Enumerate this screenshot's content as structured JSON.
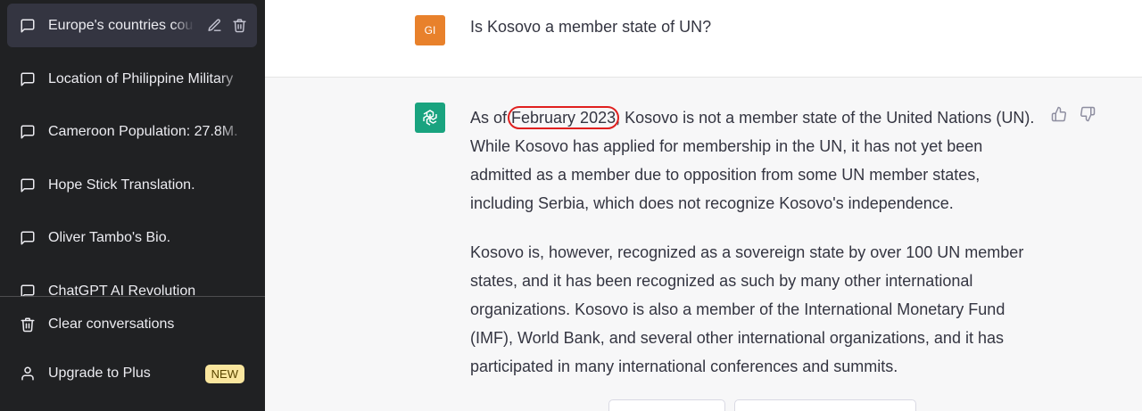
{
  "sidebar": {
    "conversations": [
      {
        "title": "Europe's countries cou"
      },
      {
        "title": "Location of Philippine Military"
      },
      {
        "title": "Cameroon Population: 27.8M."
      },
      {
        "title": "Hope Stick Translation."
      },
      {
        "title": "Oliver Tambo's Bio."
      },
      {
        "title": "ChatGPT AI Revolution"
      }
    ],
    "clear_label": "Clear conversations",
    "upgrade_label": "Upgrade to Plus",
    "upgrade_badge": "NEW"
  },
  "chat": {
    "user_avatar": "GI",
    "user_message": "Is Kosovo a member state of UN?",
    "assistant": {
      "p1_pre": "As of ",
      "p1_highlight": "February 2023",
      "p1_post": ", Kosovo is not a member state of the United Nations (UN). While Kosovo has applied for membership in the UN, it has not yet been admitted as a member due to opposition from some UN member states, including Serbia, which does not recognize Kosovo's independence.",
      "p2": "Kosovo is, however, recognized as a sovereign state by over 100 UN member states, and it has been recognized as such by many other international organizations. Kosovo is also a member of the International Monetary Fund (IMF), World Bank, and several other international organizations, and it has participated in many international conferences and summits."
    }
  },
  "colors": {
    "sidebar_bg": "#202123",
    "user_avatar": "#e8812b",
    "bot_avatar": "#19a37f",
    "highlight_outline": "#e0201f",
    "badge_bg": "#fae69e"
  },
  "icons": {
    "conversation": "chat-bubble-icon",
    "edit": "pencil-icon",
    "delete": "trash-icon",
    "clear": "trash-icon",
    "upgrade": "user-icon",
    "thumbs_up": "thumbs-up-icon",
    "thumbs_down": "thumbs-down-icon",
    "assistant": "openai-logo-icon"
  }
}
